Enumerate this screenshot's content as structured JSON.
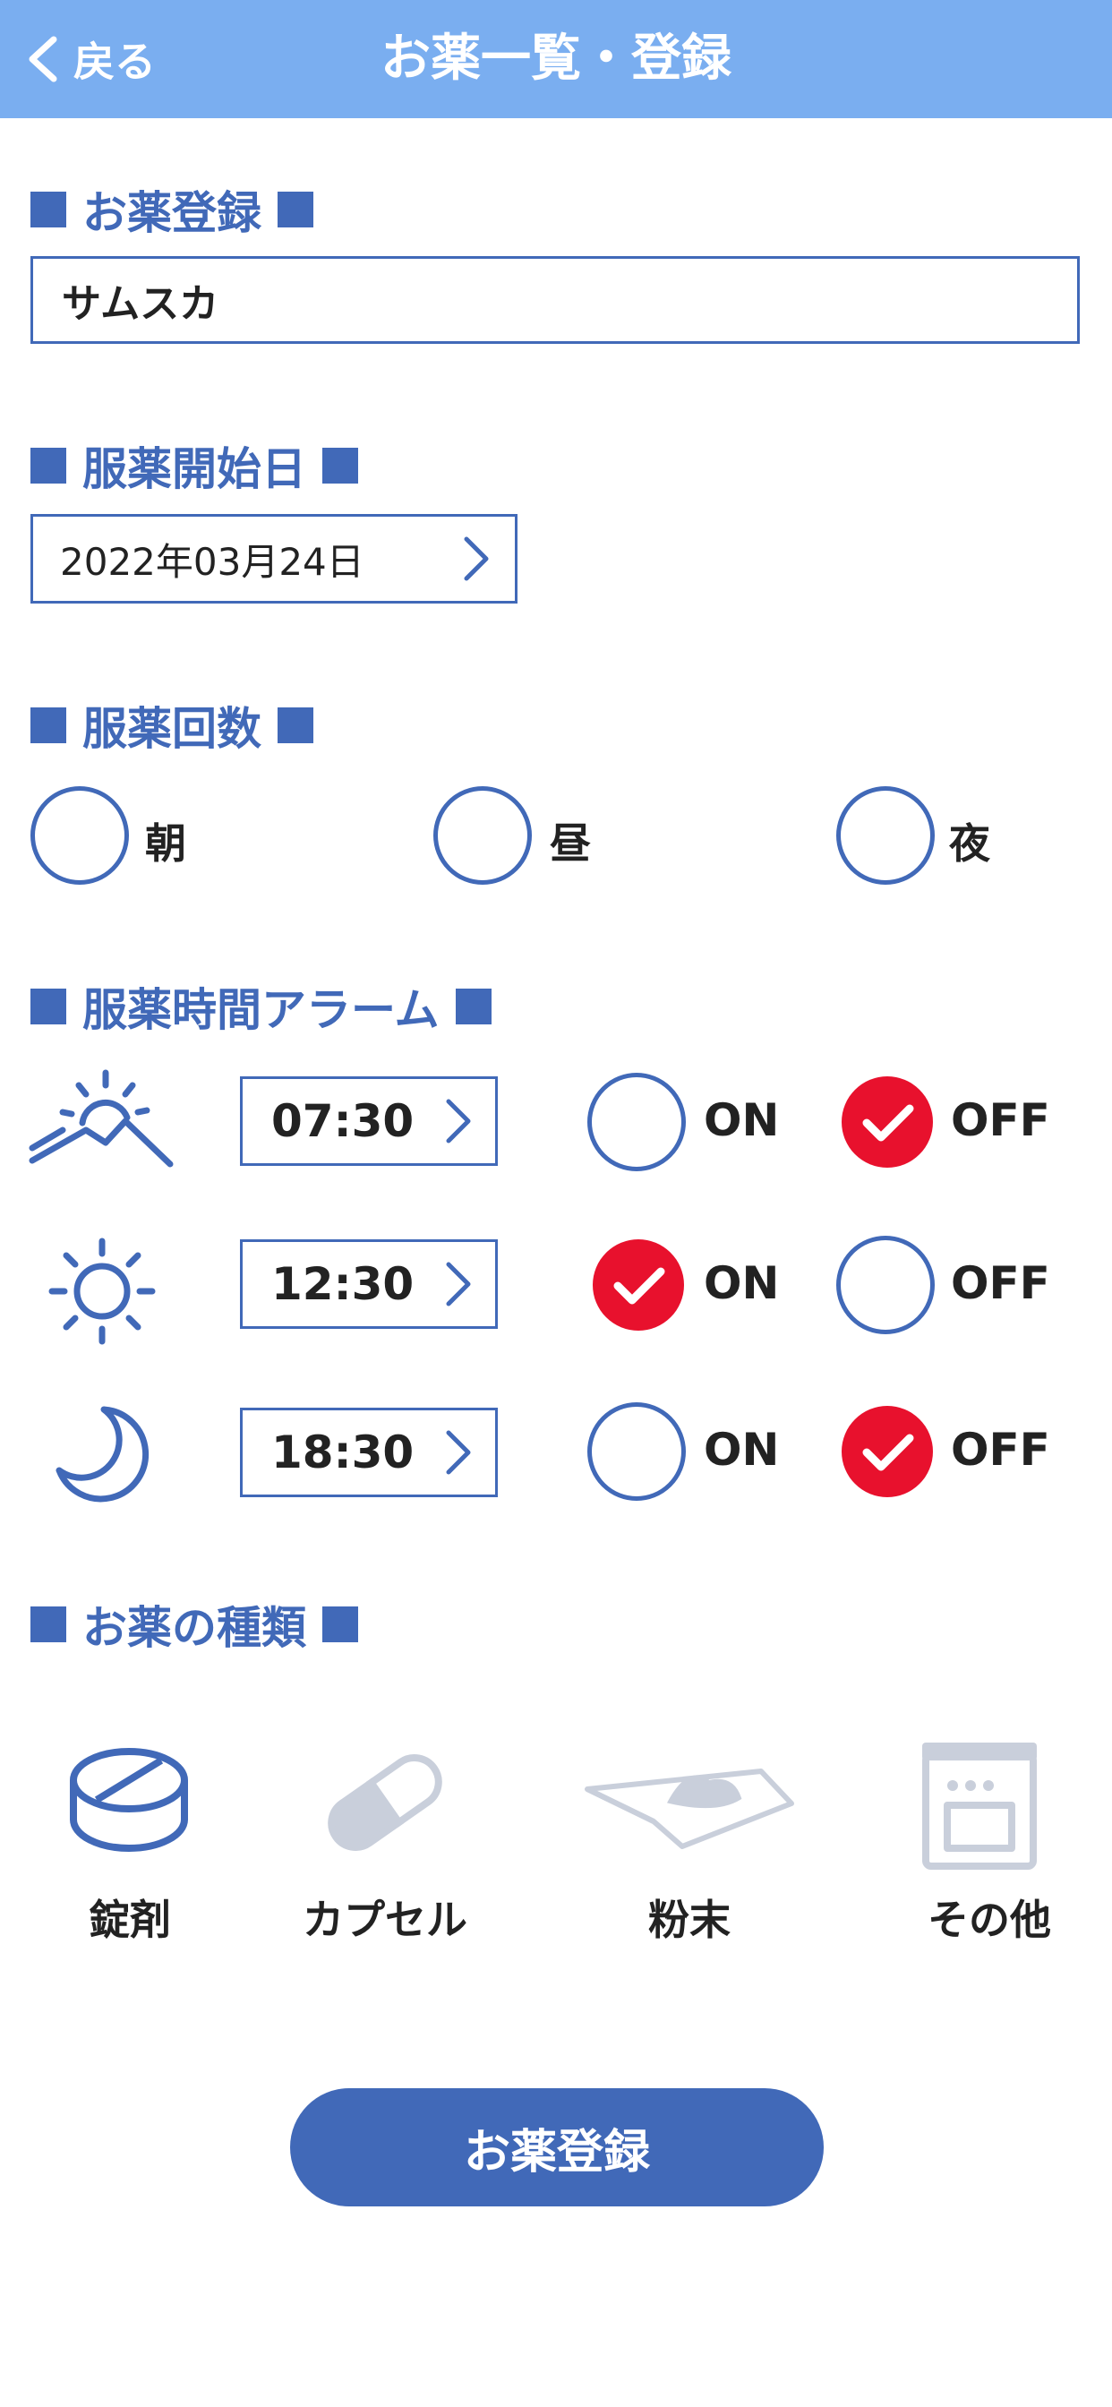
{
  "header": {
    "back_label": "戻る",
    "title": "お薬一覧・登録"
  },
  "registration": {
    "heading": "お薬登録",
    "medicine_name": "サムスカ"
  },
  "start_date": {
    "heading": "服薬開始日",
    "value": "2022年03月24日"
  },
  "frequency": {
    "heading": "服薬回数",
    "options": [
      {
        "label": "朝",
        "checked": false
      },
      {
        "label": "昼",
        "checked": false
      },
      {
        "label": "夜",
        "checked": false
      }
    ]
  },
  "alarm": {
    "heading": "服薬時間アラーム",
    "on_label": "ON",
    "off_label": "OFF",
    "rows": [
      {
        "icon": "sunrise-icon",
        "time": "07:30",
        "state": "OFF"
      },
      {
        "icon": "sun-icon",
        "time": "12:30",
        "state": "ON"
      },
      {
        "icon": "moon-icon",
        "time": "18:30",
        "state": "OFF"
      }
    ]
  },
  "types": {
    "heading": "お薬の種類",
    "items": [
      {
        "label": "錠剤",
        "icon": "tablet-icon",
        "selected": true
      },
      {
        "label": "カプセル",
        "icon": "capsule-icon",
        "selected": false
      },
      {
        "label": "粉末",
        "icon": "powder-icon",
        "selected": false
      },
      {
        "label": "その他",
        "icon": "other-package-icon",
        "selected": false
      }
    ]
  },
  "submit_label": "お薬登録",
  "colors": {
    "header": "#7aaef0",
    "accent": "#4169b8",
    "checked": "#e8112d",
    "inactive_icon": "#c9cfdb"
  }
}
